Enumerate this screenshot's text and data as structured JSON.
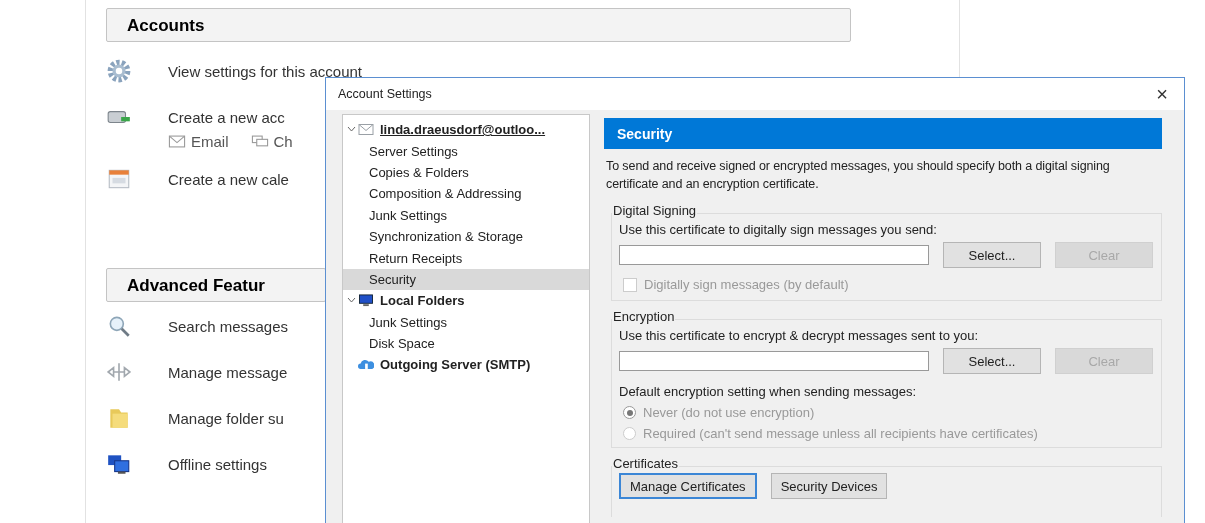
{
  "accounts": {
    "title": "Accounts",
    "items": [
      {
        "kind": "settings",
        "label": "View settings for this account"
      },
      {
        "kind": "new-account",
        "label": "Create a new acc",
        "links": [
          {
            "kind": "email",
            "label": "Email"
          },
          {
            "kind": "chat",
            "label": "Ch"
          }
        ]
      },
      {
        "kind": "calendar",
        "label": "Create a new cale"
      }
    ]
  },
  "advanced": {
    "title": "Advanced Featur",
    "items": [
      {
        "kind": "search",
        "label": "Search messages"
      },
      {
        "kind": "filters",
        "label": "Manage message"
      },
      {
        "kind": "folder",
        "label": "Manage folder su"
      },
      {
        "kind": "offline",
        "label": "Offline settings"
      }
    ]
  },
  "dialog": {
    "title": "Account Settings",
    "close": "×",
    "tree": [
      {
        "kind": "account",
        "label": "linda.draeusdorf@outloo...",
        "expanded": true,
        "selected": false,
        "children": [
          {
            "label": "Server Settings",
            "selected": false
          },
          {
            "label": "Copies & Folders",
            "selected": false
          },
          {
            "label": "Composition & Addressing",
            "selected": false
          },
          {
            "label": "Junk Settings",
            "selected": false
          },
          {
            "label": "Synchronization & Storage",
            "selected": false
          },
          {
            "label": "Return Receipts",
            "selected": false
          },
          {
            "label": "Security",
            "selected": true
          }
        ]
      },
      {
        "kind": "local",
        "label": "Local Folders",
        "expanded": true,
        "selected": false,
        "children": [
          {
            "label": "Junk Settings",
            "selected": false
          },
          {
            "label": "Disk Space",
            "selected": false
          }
        ]
      },
      {
        "kind": "server",
        "label": "Outgoing Server (SMTP)",
        "selected": false
      }
    ],
    "panel": {
      "title": "Security",
      "description": "To send and receive signed or encrypted messages, you should specify both a digital signing certificate and an encryption certificate.",
      "signing": {
        "title": "Digital Signing",
        "prompt": "Use this certificate to digitally sign messages you send:",
        "buttons": [
          {
            "label": "Select...",
            "disabled": false
          },
          {
            "label": "Clear",
            "disabled": true
          }
        ],
        "checkbox": {
          "label": "Digitally sign messages (by default)",
          "checked": false,
          "disabled": true
        }
      },
      "encryption": {
        "title": "Encryption",
        "prompt": "Use this certificate to encrypt & decrypt messages sent to you:",
        "buttons": [
          {
            "label": "Select...",
            "disabled": false
          },
          {
            "label": "Clear",
            "disabled": true
          }
        ],
        "default_label": "Default encryption setting when sending messages:",
        "options": [
          {
            "label": "Never (do not use encryption)",
            "selected": true,
            "disabled": true
          },
          {
            "label": "Required (can't send message unless all recipients have certificates)",
            "selected": false,
            "disabled": true
          }
        ]
      },
      "certificates": {
        "title": "Certificates",
        "buttons": [
          {
            "label": "Manage Certificates",
            "focused": true
          },
          {
            "label": "Security Devices",
            "focused": false
          }
        ]
      }
    }
  }
}
